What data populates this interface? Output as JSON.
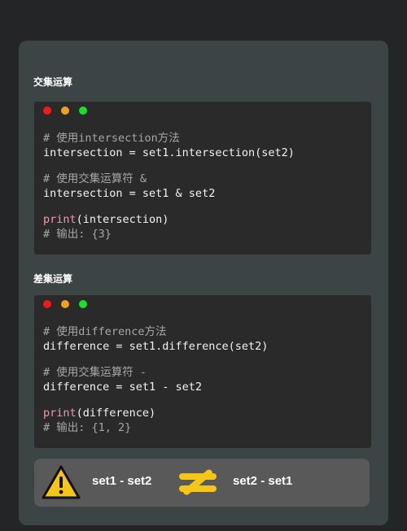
{
  "sections": [
    {
      "title": "交集运算",
      "code": {
        "block1": [
          "# 使用intersection方法",
          "intersection = set1.intersection(set2)"
        ],
        "block2": [
          "# 使用交集运算符 &",
          "intersection = set1 & set2"
        ],
        "print_kw": "print",
        "print_args": "(intersection)",
        "output_comment": "# 输出: {3}"
      }
    },
    {
      "title": "差集运算",
      "code": {
        "block1": [
          "# 使用difference方法",
          "difference = set1.difference(set2)"
        ],
        "block2": [
          "# 使用交集运算符 -",
          "difference = set1 - set2"
        ],
        "print_kw": "print",
        "print_args": "(difference)",
        "output_comment": "# 输出: {1, 2}"
      }
    }
  ],
  "legend": {
    "left_text": "set1 - set2",
    "right_text": "set2 - set1",
    "warning_icon": "warning-triangle-icon",
    "not_equal_icon": "not-equal-icon"
  },
  "colors": {
    "window_red": "#f21919",
    "window_yellow": "#f0a019",
    "window_green": "#19e02b",
    "keyword": "#f29aa8",
    "accent_yellow": "#f5c518"
  }
}
